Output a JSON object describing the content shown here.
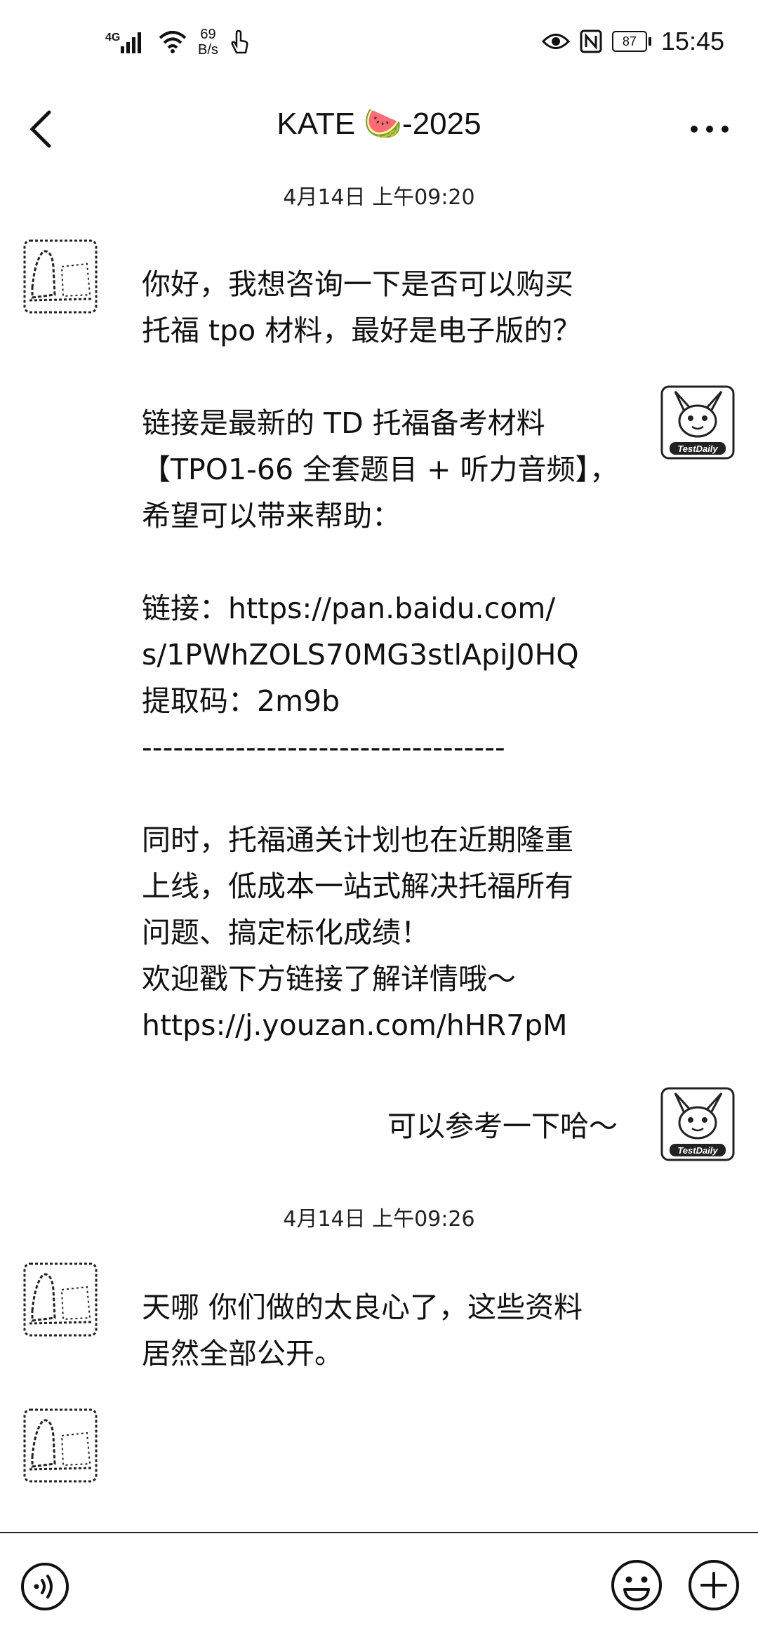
{
  "status_bar": {
    "network": "4G",
    "speed_value": "69",
    "speed_unit": "B/s",
    "battery": "87",
    "time": "15:45"
  },
  "header": {
    "title": "KATE 🍉-2025"
  },
  "messages": [
    {
      "timestamp": "4月14日 上午09:20",
      "text": "你好，我想咨询一下是否可以购买\n托福 tpo 材料，最好是电子版的？"
    },
    {
      "text": "链接是最新的 TD 托福备考材料\n【TPO1-66 全套题目 + 听力音频】，\n希望可以带来帮助：\n\n链接：https://pan.baidu.com/\ns/1PWhZOLS70MG3stlApiJ0HQ\n提取码：2m9b\n-----------------------------------\n\n同时，托福通关计划也在近期隆重\n上线，低成本一站式解决托福所有\n问题、搞定标化成绩！\n欢迎戳下方链接了解详情哦～\nhttps://j.youzan.com/hHR7pM"
    },
    {
      "text": "可以参考一下哈～"
    },
    {
      "timestamp": "4月14日 上午09:26",
      "text": "天哪 你们做的太良心了，这些资料\n居然全部公开。"
    },
    {
      "text": ""
    }
  ],
  "avatars": {
    "self_label": "TestDaily"
  },
  "icons": {
    "back": "chevron-left-icon",
    "more": "more-horizontal-icon",
    "voice": "voice-icon",
    "emoji": "emoji-icon",
    "plus": "plus-icon"
  }
}
